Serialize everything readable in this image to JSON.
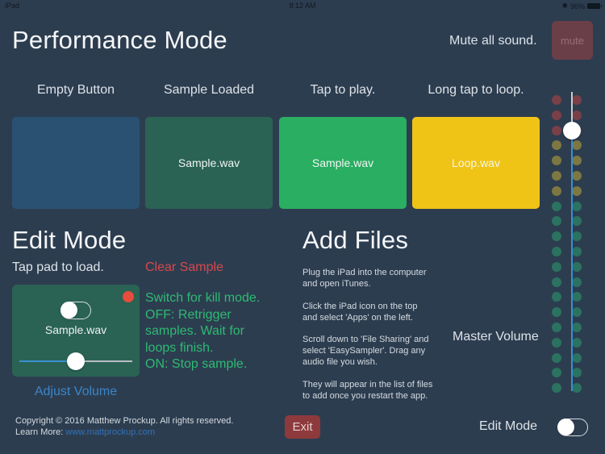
{
  "status_bar": {
    "device": "iPad",
    "time": "8:12 AM",
    "battery": "96%"
  },
  "performance": {
    "title": "Performance Mode",
    "mute_label": "Mute all sound.",
    "mute_button": "mute",
    "pads": [
      {
        "label": "Empty Button",
        "file": "",
        "state": "empty",
        "color": "#2a5172"
      },
      {
        "label": "Sample Loaded",
        "file": "Sample.wav",
        "state": "loaded",
        "color": "#2a6354"
      },
      {
        "label": "Tap to play.",
        "file": "Sample.wav",
        "state": "playing",
        "color": "#29ae62"
      },
      {
        "label": "Long tap to loop.",
        "file": "Loop.wav",
        "state": "looping",
        "color": "#f0c416"
      }
    ]
  },
  "edit": {
    "title": "Edit Mode",
    "instruction": "Tap pad to load.",
    "clear_sample": "Clear Sample",
    "card_file": "Sample.wav",
    "kill_toggle_on": false,
    "volume_value": 0.5,
    "adjust_volume": "Adjust Volume",
    "kill_help": [
      "Switch for kill mode.",
      "OFF: Retrigger",
      "samples. Wait for",
      "loops finish.",
      "ON: Stop sample."
    ]
  },
  "add_files": {
    "title": "Add Files",
    "steps": [
      [
        "Plug the iPad into the computer",
        "and open iTunes."
      ],
      [
        "Click the iPad icon on the top",
        "and select 'Apps' on the left."
      ],
      [
        "Scroll down to 'File Sharing' and",
        "select 'EasySampler'. Drag any",
        "audio file you wish."
      ],
      [
        "They will appear in the list of files",
        "to add once you restart the app."
      ]
    ]
  },
  "master_volume": {
    "label": "Master Volume",
    "value": 0.87,
    "meter_rows": 20,
    "meter_colors": {
      "red": "#7a4048",
      "yellow": "#7d7741",
      "green": "#2b7260"
    },
    "meter_red_rows": 3,
    "meter_yellow_rows": 4
  },
  "footer": {
    "copyright": "Copyright © 2016 Matthew Prockup. All rights reserved.",
    "learn_more": "Learn More:",
    "link": "www.mattprockup.com",
    "exit_button": "Exit",
    "edit_mode_label": "Edit Mode",
    "edit_mode_on": false
  }
}
